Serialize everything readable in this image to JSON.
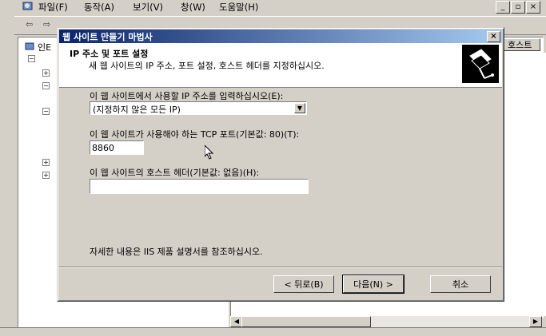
{
  "menubar": {
    "items": [
      "파일(F)",
      "동작(A)",
      "보기(V)",
      "창(W)",
      "도움말(H)"
    ],
    "mdi_buttons": [
      "_",
      "▫",
      "×"
    ]
  },
  "toolbar": {
    "back": "⇦",
    "forward": "⇨"
  },
  "tree": {
    "root_label_partial": "인E"
  },
  "list": {
    "column_header": "호스트"
  },
  "wizard": {
    "title": "웹 사이트 만들기 마법사",
    "close_label": "×",
    "header_title": "IP 주소 및 포트 설정",
    "header_subtitle": "새 웹 사이트의 IP 주소, 포트 설정, 호스트 헤더를 지정하십시오.",
    "ip_label": "이 웹 사이트에서 사용할 IP 주소를 입력하십시오(E):",
    "ip_value": "(지정하지 않은 모든 IP)",
    "port_label": "이 웹 사이트가 사용해야 하는 TCP 포트(기본값: 80)(T):",
    "port_value": "8860",
    "host_label": "이 웹 사이트의 호스트 헤더(기본값: 없음)(H):",
    "host_value": "",
    "help_text": "자세한 내용은 IIS 제품 설명서를 참조하십시오.",
    "buttons": {
      "back": "< 뒤로(B)",
      "next": "다음(N) >",
      "cancel": "취소"
    }
  },
  "colors": {
    "titlebar_start": "#0a246a",
    "titlebar_end": "#a6caf0",
    "face": "#d4d0c8"
  }
}
